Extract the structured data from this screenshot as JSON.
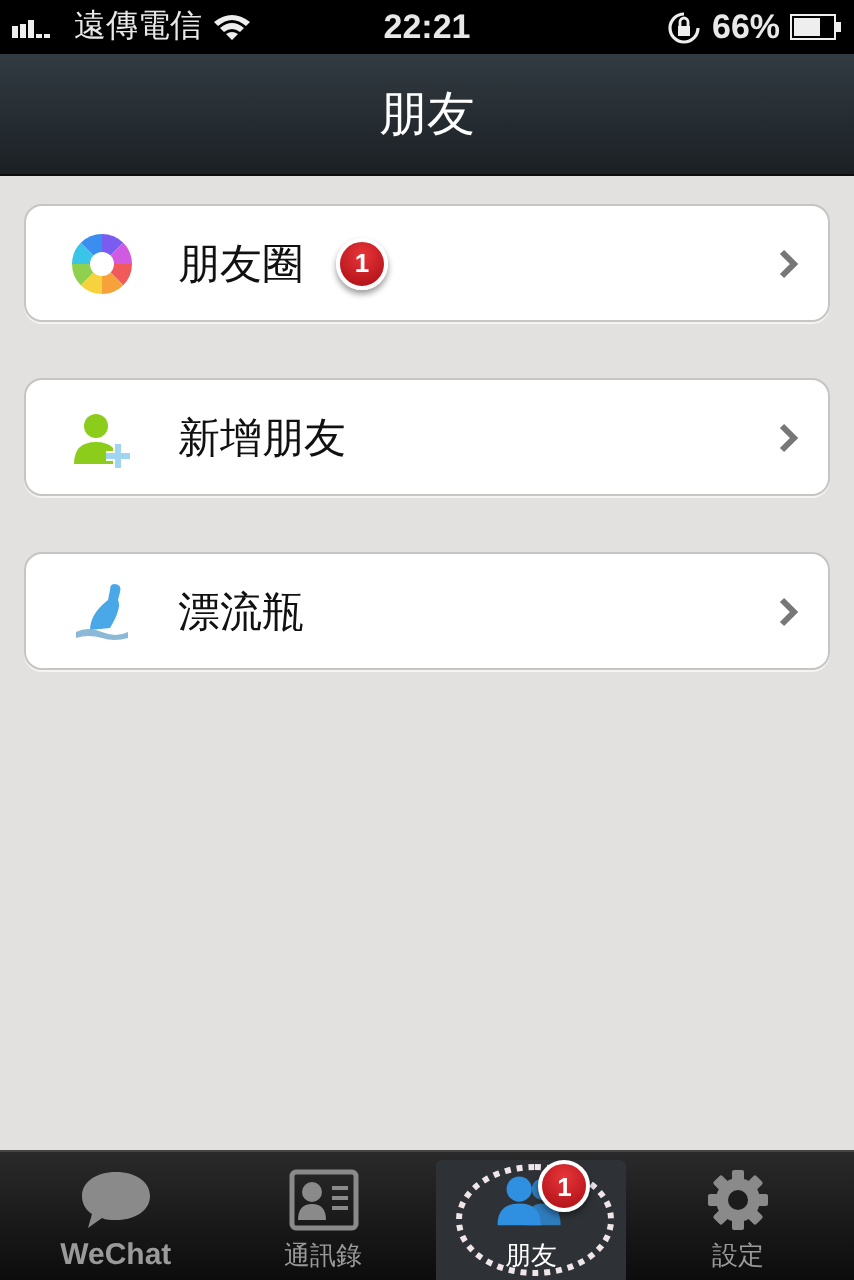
{
  "status_bar": {
    "carrier": "遠傳電信",
    "time": "22:21",
    "battery": "66%"
  },
  "nav_bar": {
    "title": "朋友"
  },
  "items": [
    {
      "kind": "moments",
      "label": "朋友圈",
      "badge": "1"
    },
    {
      "kind": "add-friend",
      "label": "新增朋友"
    },
    {
      "kind": "bottle",
      "label": "漂流瓶"
    }
  ],
  "tab_bar": [
    {
      "kind": "chat",
      "label": "WeChat",
      "selected": false
    },
    {
      "kind": "contacts",
      "label": "通訊錄",
      "selected": false
    },
    {
      "kind": "friends",
      "label": "朋友",
      "selected": true,
      "badge": "1"
    },
    {
      "kind": "settings",
      "label": "設定",
      "selected": false
    }
  ]
}
